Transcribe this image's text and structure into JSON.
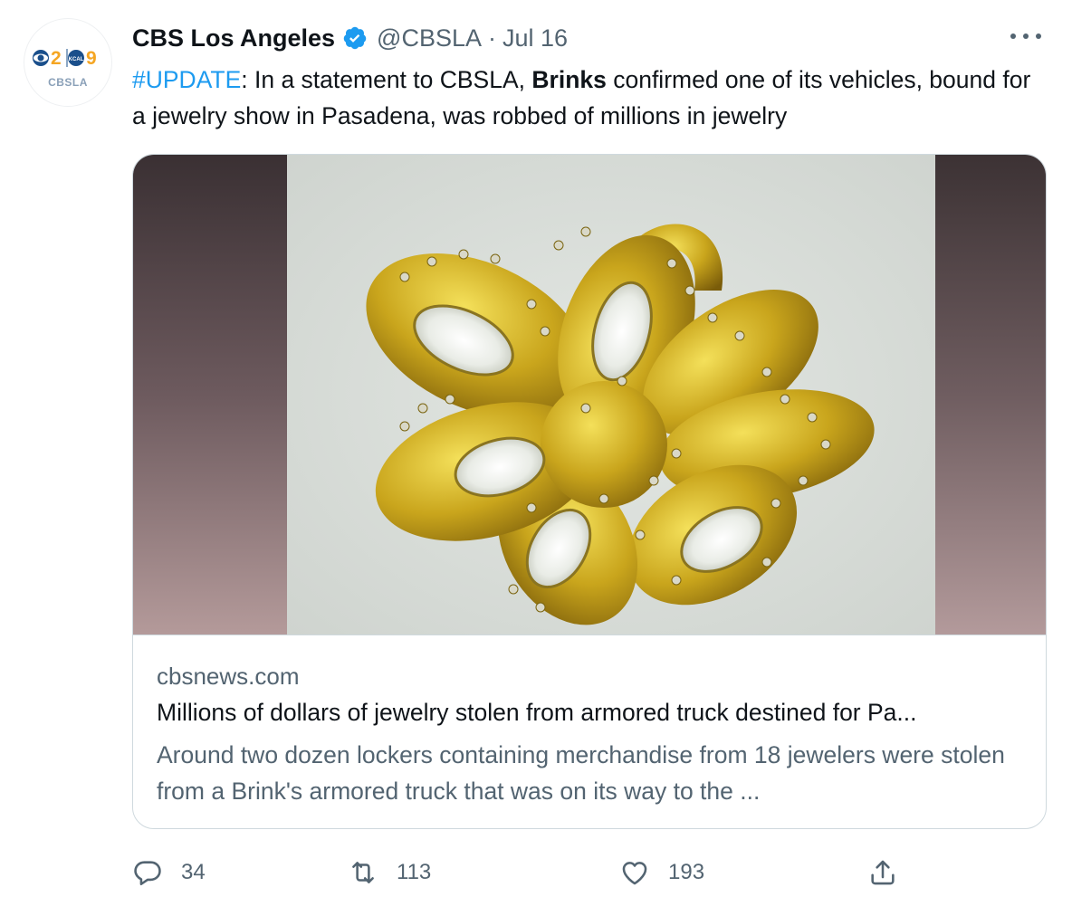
{
  "account": {
    "name": "CBS Los Angeles",
    "handle": "@CBSLA",
    "separator": "·",
    "date": "Jul 16",
    "avatar_text": "CBSLA",
    "avatar_logo": "2 KCAL 9"
  },
  "tweet": {
    "hashtag": "#UPDATE",
    "text_part1": ": In a statement to CBSLA, ",
    "bold": "Brinks",
    "text_part2": " confirmed one of its vehicles, bound for a jewelry show in Pasadena, was robbed of millions in jewelry"
  },
  "card": {
    "domain": "cbsnews.com",
    "title": "Millions of dollars of jewelry stolen from armored truck destined for Pa...",
    "description": "Around two dozen lockers containing merchandise from 18 jewelers were stolen from a Brink's armored truck that was on its way to the ..."
  },
  "actions": {
    "reply_count": "34",
    "retweet_count": "113",
    "like_count": "193"
  },
  "colors": {
    "link": "#1d9bf0",
    "secondary_text": "#536471",
    "border": "#cfd9de",
    "verified": "#1d9bf0"
  },
  "icons": [
    "more-icon",
    "verified-icon",
    "reply-icon",
    "retweet-icon",
    "like-icon",
    "share-icon"
  ]
}
